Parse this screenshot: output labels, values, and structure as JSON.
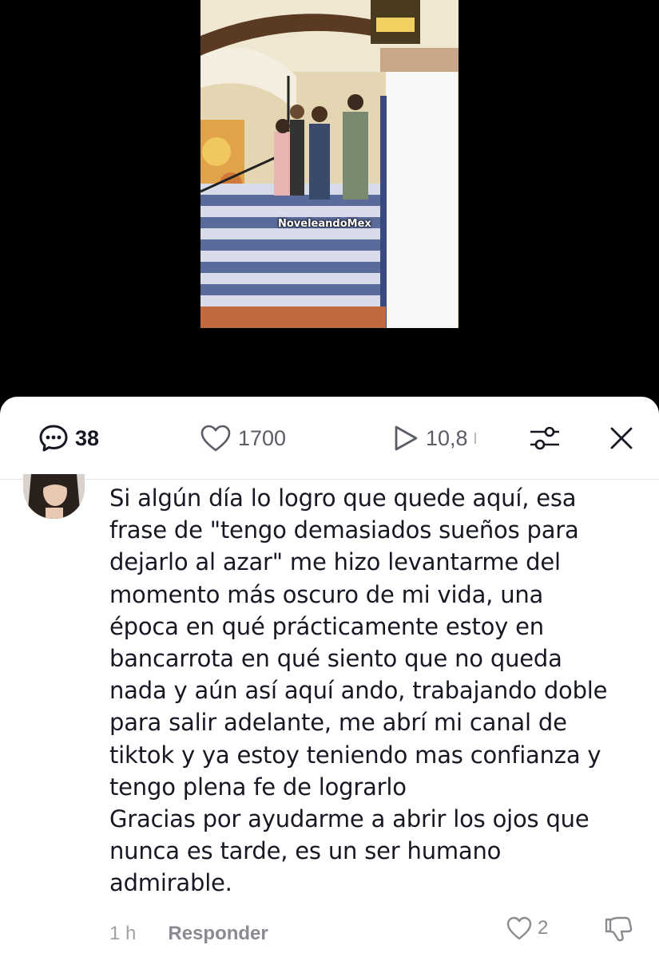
{
  "video": {
    "watermark": "NoveleandoMex"
  },
  "toolbar": {
    "comments_count": "38",
    "likes_count": "1700",
    "views_count": "10,8",
    "icons": [
      "comment-icon",
      "heart-icon",
      "play-icon",
      "filter-sliders-icon",
      "close-icon"
    ]
  },
  "comment": {
    "lines": [
      "Si algún día lo logro que quede aquí, esa",
      "frase de \"tengo demasiados sueños para",
      "dejarlo al azar\" me hizo levantarme del",
      "momento más oscuro de mi vida, una",
      "época en qué prácticamente estoy en",
      "bancarrota en qué siento que no queda",
      "nada y aún así aquí ando, trabajando doble",
      "para salir adelante, me abrí mi canal de",
      "tiktok y ya estoy teniendo mas confianza y",
      "tengo plena fe de lograrlo",
      "Gracias por ayudarme a abrir los ojos que",
      "nunca es tarde, es un ser humano",
      "admirable."
    ],
    "time": "1 h",
    "reply_label": "Responder",
    "likes": "2"
  }
}
